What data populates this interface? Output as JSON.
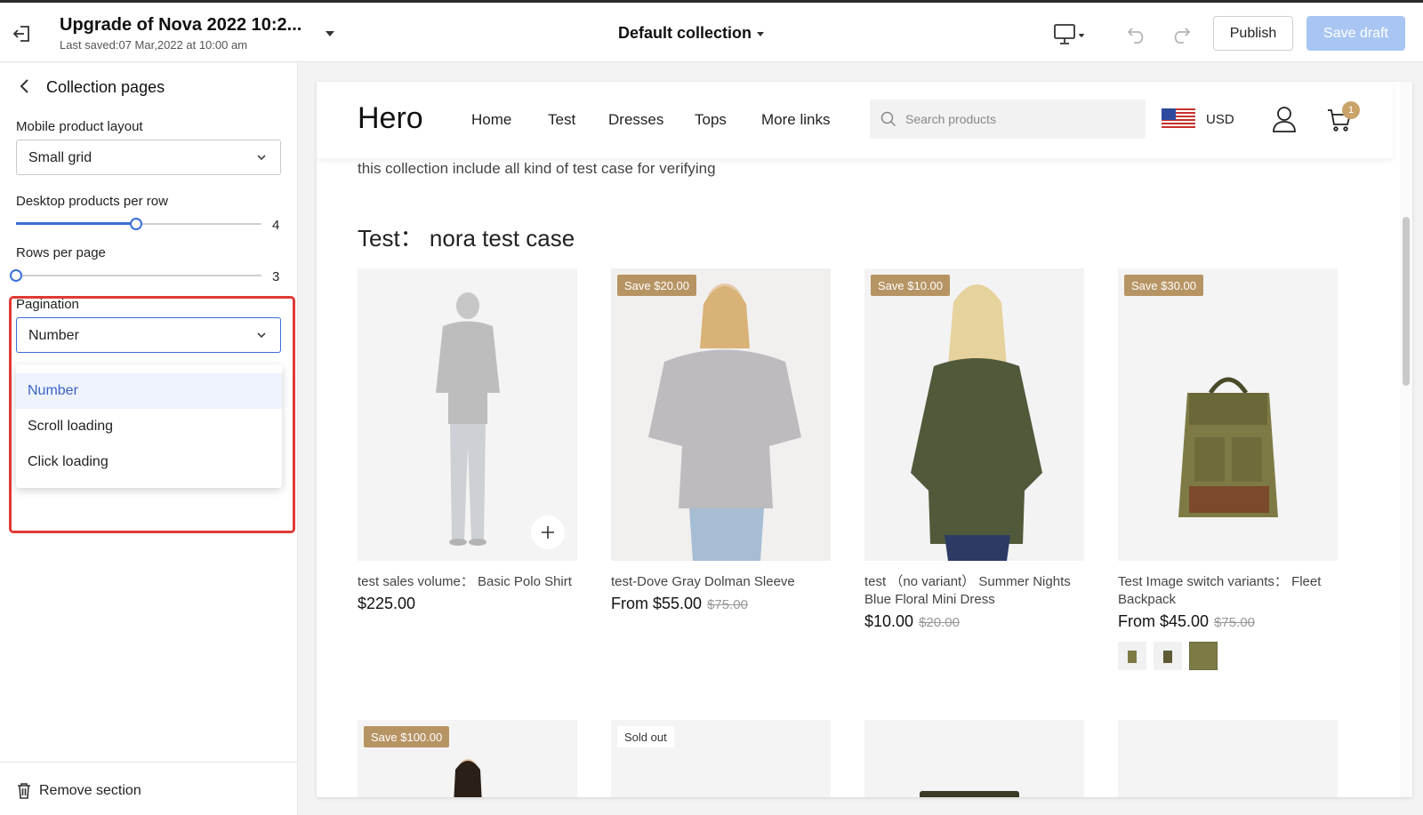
{
  "topbar": {
    "title": "Upgrade of Nova 2022 10:2...",
    "last_saved": "Last saved:07 Mar,2022 at 10:00 am",
    "collection": "Default collection",
    "publish_label": "Publish",
    "save_draft_label": "Save draft"
  },
  "sidebar": {
    "title": "Collection pages",
    "mobile_layout": {
      "label": "Mobile product layout",
      "value": "Small grid"
    },
    "desktop_per_row": {
      "label": "Desktop products per row",
      "value": "4",
      "fraction": 0.49
    },
    "rows_per_page": {
      "label": "Rows per page",
      "value": "3",
      "fraction": 0.0
    },
    "pagination": {
      "label": "Pagination",
      "value": "Number",
      "options": [
        "Number",
        "Scroll loading",
        "Click loading"
      ]
    },
    "remove_label": "Remove section"
  },
  "store": {
    "logo": "Hero",
    "nav": [
      "Home",
      "Test",
      "Dresses",
      "Tops",
      "More links"
    ],
    "search_placeholder": "Search products",
    "currency": "USD",
    "cart_count": "1",
    "collection_desc": "this collection include all kind of test case for verifying",
    "collection_title": "Test： nora test case",
    "products": [
      {
        "name": "test sales volume： Basic Polo Shirt",
        "price": "$225.00",
        "old_price": "",
        "badge": ""
      },
      {
        "name": "test-Dove Gray Dolman Sleeve",
        "price": "From $55.00",
        "old_price": "$75.00",
        "badge": "Save $20.00"
      },
      {
        "name": "test （no variant） Summer Nights Blue Floral Mini Dress",
        "price": "$10.00",
        "old_price": "$20.00",
        "badge": "Save $10.00"
      },
      {
        "name": "Test Image switch variants： Fleet Backpack",
        "price": "From $45.00",
        "old_price": "$75.00",
        "badge": "Save $30.00"
      }
    ],
    "row2_badges": [
      "Save $100.00",
      "Sold out"
    ]
  },
  "colors": {
    "accent": "#3a6fd8",
    "badge": "#b79464",
    "save_draft_bg": "#a9c6f3",
    "highlight": "#e03a35"
  }
}
